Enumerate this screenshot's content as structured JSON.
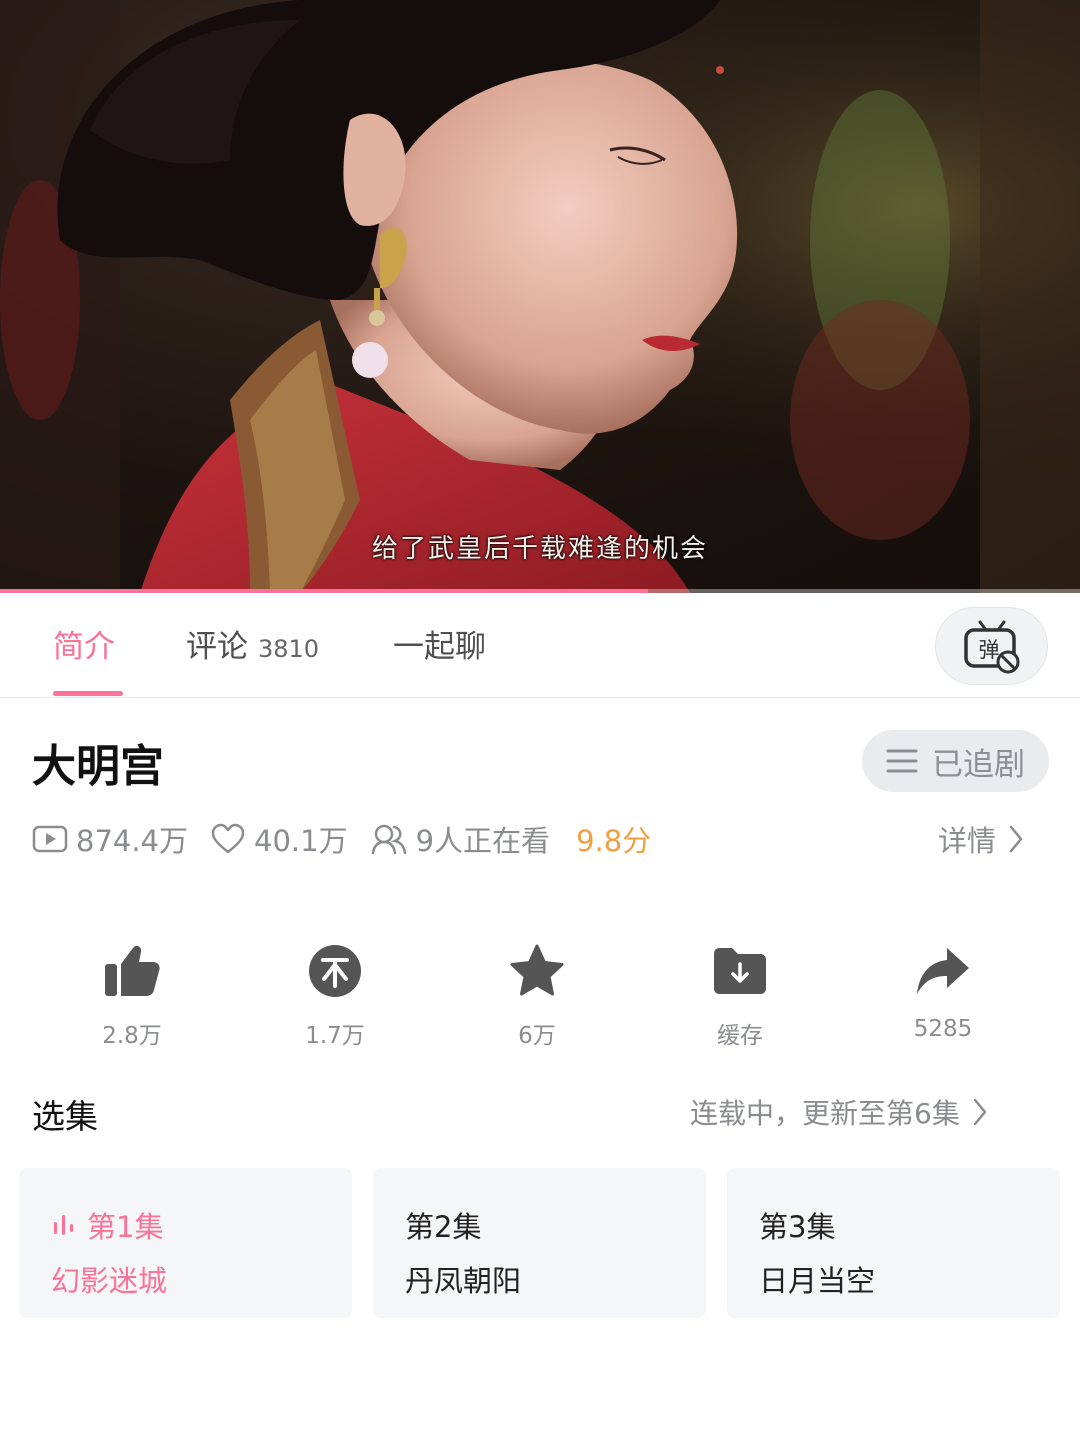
{
  "player": {
    "subtitle": "给了武皇后千载难逢的机会",
    "progress_percent": 60
  },
  "tabs": [
    {
      "label": "简介",
      "active": true
    },
    {
      "label": "评论",
      "count": "3810"
    },
    {
      "label": "一起聊"
    }
  ],
  "danmaku_toggle": {
    "icon": "danmaku-off-icon",
    "glyph": "弹"
  },
  "show": {
    "title": "大明宫",
    "follow_label": "已追剧",
    "views": "874.4万",
    "likes": "40.1万",
    "watching": "9人正在看",
    "score": "9.8分",
    "detail_label": "详情"
  },
  "actions": [
    {
      "icon": "thumbs-up-icon",
      "label": "2.8万"
    },
    {
      "icon": "coin-icon",
      "label": "1.7万"
    },
    {
      "icon": "star-icon",
      "label": "6万"
    },
    {
      "icon": "download-folder-icon",
      "label": "缓存"
    },
    {
      "icon": "share-icon",
      "label": "5285"
    }
  ],
  "episodes": {
    "section_title": "选集",
    "status": "连载中，更新至第6集",
    "items": [
      {
        "number": "第1集",
        "title": "幻影迷城",
        "active": true
      },
      {
        "number": "第2集",
        "title": "丹凤朝阳"
      },
      {
        "number": "第3集",
        "title": "日月当空"
      }
    ]
  },
  "colors": {
    "accent": "#fb7299",
    "score": "#f0a040",
    "muted": "#8a8c8f"
  }
}
